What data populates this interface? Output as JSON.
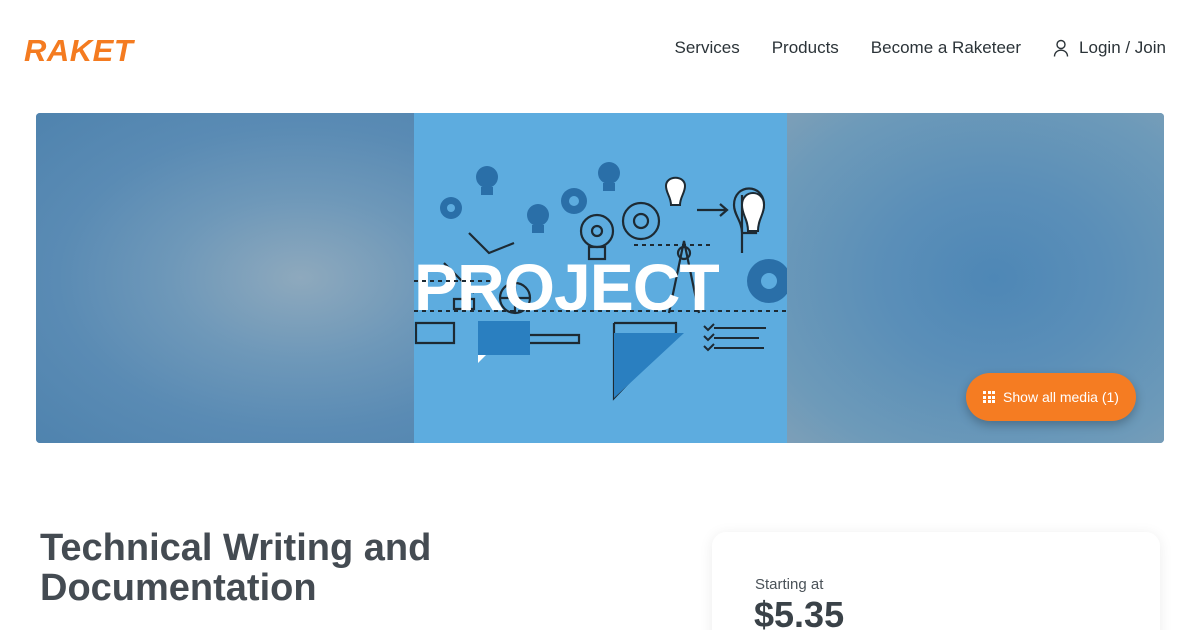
{
  "brand": {
    "name": "RAKET",
    "color": "#f47b20"
  },
  "nav": {
    "items": [
      {
        "label": "Services"
      },
      {
        "label": "Products"
      },
      {
        "label": "Become a Raketeer"
      }
    ],
    "login_label": "Login / Join",
    "login_icon": "user-icon"
  },
  "hero": {
    "image_word": "PROJECT",
    "media_button_label": "Show all media (1)",
    "media_button_icon": "grid-icon",
    "accent_color": "#f57c22"
  },
  "listing": {
    "title_line1": "Technical Writing and",
    "title_line2": "Documentation"
  },
  "price": {
    "label": "Starting at",
    "value": "$5.35"
  }
}
